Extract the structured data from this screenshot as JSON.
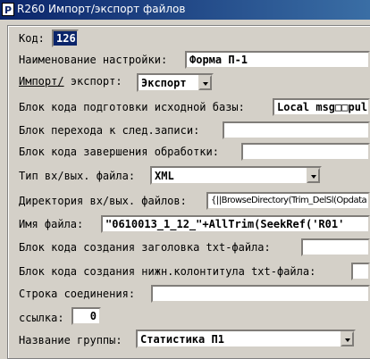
{
  "window": {
    "title": "R260 Импорт/экспорт файлов"
  },
  "form": {
    "kod": {
      "label": "Код:",
      "value": "126"
    },
    "name": {
      "label": "Наименование настройки:",
      "value": "Форма П-1"
    },
    "mode": {
      "label_a": "Импорт/",
      "label_b": " экспорт:",
      "value": "Экспорт"
    },
    "prep_block": {
      "label": "Блок кода подготовки исходной базы:",
      "value": "Local msg□□pul"
    },
    "next_block": {
      "label": "Блок перехода к след.записи:",
      "value": ""
    },
    "end_block": {
      "label": "Блок кода завершения обработки:",
      "value": ""
    },
    "file_type": {
      "label": "Тип вх/вых. файла:",
      "value": "XML"
    },
    "directory": {
      "label": "Директория вх/вых. файлов:",
      "value": "{||BrowseDirectory(Trim_DelSl(Opdata"
    },
    "file_name": {
      "label": "Имя  файла:",
      "value": "\"0610013_1_12_\"+AllTrim(SeekRef('R01'"
    },
    "header_block": {
      "label": "Блок кода создания заголовка txt-файла:",
      "value": ""
    },
    "footer_block": {
      "label": "Блок кода создания нижн.колонтитула txt-файла:",
      "value": ""
    },
    "connection": {
      "label": "Строка соединения:",
      "value": ""
    },
    "link": {
      "label": "ссылка:",
      "value": "0"
    },
    "group": {
      "label": "Название группы:",
      "value": "Статистика П1"
    }
  }
}
